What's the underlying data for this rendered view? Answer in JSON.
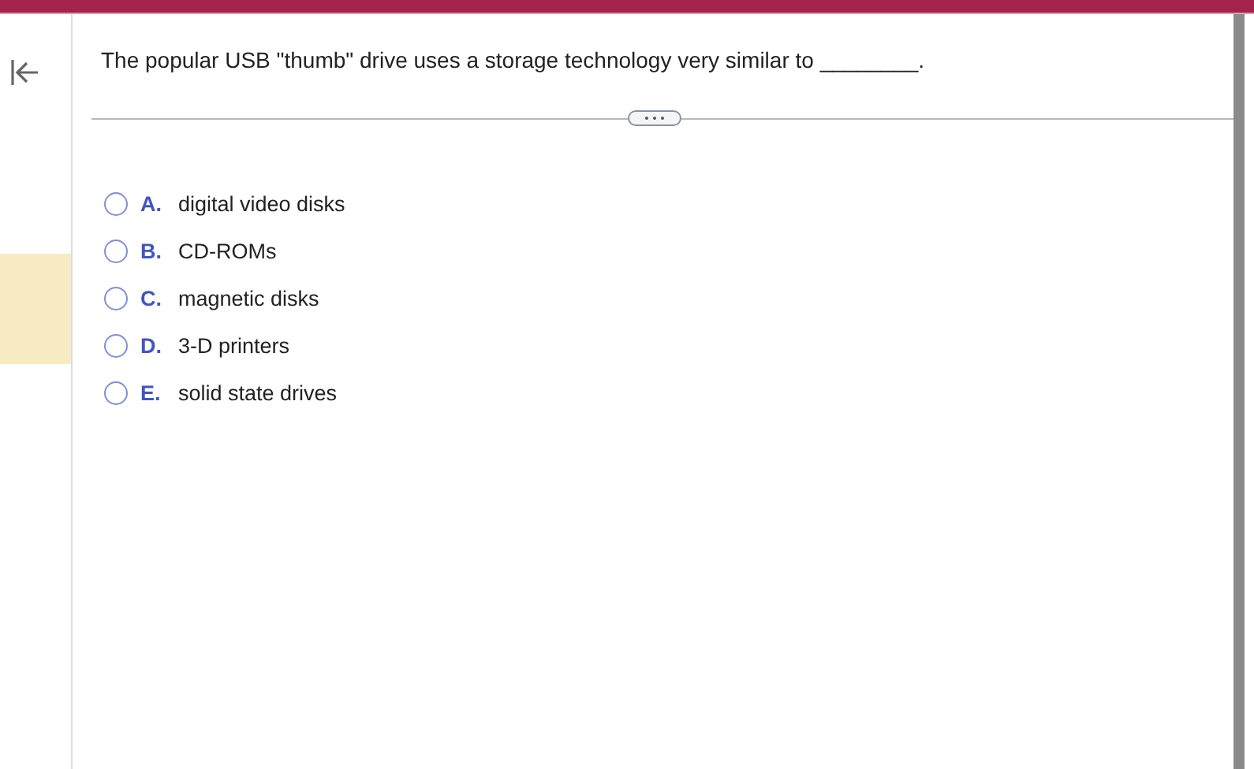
{
  "question": {
    "text": "The popular USB \"thumb\" drive uses a storage technology very similar to ________."
  },
  "options": [
    {
      "letter": "A.",
      "text": "digital video disks",
      "selected": false
    },
    {
      "letter": "B.",
      "text": "CD-ROMs",
      "selected": false
    },
    {
      "letter": "C.",
      "text": "magnetic disks",
      "selected": false
    },
    {
      "letter": "D.",
      "text": "3-D printers",
      "selected": false
    },
    {
      "letter": "E.",
      "text": "solid state drives",
      "selected": false
    }
  ]
}
